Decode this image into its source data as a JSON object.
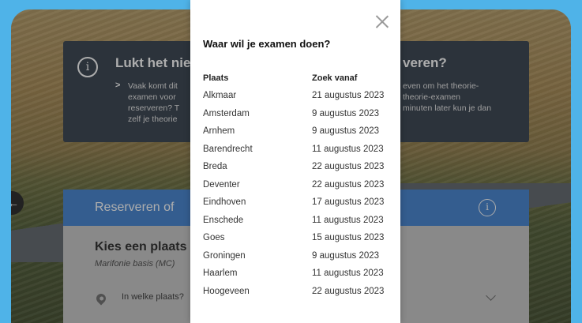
{
  "notice": {
    "title_left": "Lukt het nie",
    "title_right": "veren?",
    "bullet_icon": "chevron-right-icon",
    "body_left": "Vaak komt dit\nexamen voor\nreserveren? T\nzelf je theorie",
    "body_right": "even om het theorie-\ntheorie-examen\nminuten later kun je dan"
  },
  "reserve": {
    "header": "Reserveren of",
    "title": "Kies een plaats e",
    "subtitle": "Marifonie basis (MC)",
    "question": "In welke plaats?"
  },
  "modal": {
    "heading": "Waar wil je examen doen?",
    "col_place": "Plaats",
    "col_date": "Zoek vanaf",
    "rows": [
      {
        "place": "Alkmaar",
        "date": "21 augustus 2023"
      },
      {
        "place": "Amsterdam",
        "date": "9 augustus 2023"
      },
      {
        "place": "Arnhem",
        "date": "9 augustus 2023"
      },
      {
        "place": "Barendrecht",
        "date": "11 augustus 2023"
      },
      {
        "place": "Breda",
        "date": "22 augustus 2023"
      },
      {
        "place": "Deventer",
        "date": "22 augustus 2023"
      },
      {
        "place": "Eindhoven",
        "date": "17 augustus 2023"
      },
      {
        "place": "Enschede",
        "date": "11 augustus 2023"
      },
      {
        "place": "Goes",
        "date": "15 augustus 2023"
      },
      {
        "place": "Groningen",
        "date": "9 augustus 2023"
      },
      {
        "place": "Haarlem",
        "date": "11 augustus 2023"
      },
      {
        "place": "Hoogeveen",
        "date": "22 augustus 2023"
      }
    ]
  },
  "colors": {
    "outer_background": "#4fb3e8",
    "notice_background": "#2f3a47",
    "header_blue": "#3d7fcf"
  }
}
